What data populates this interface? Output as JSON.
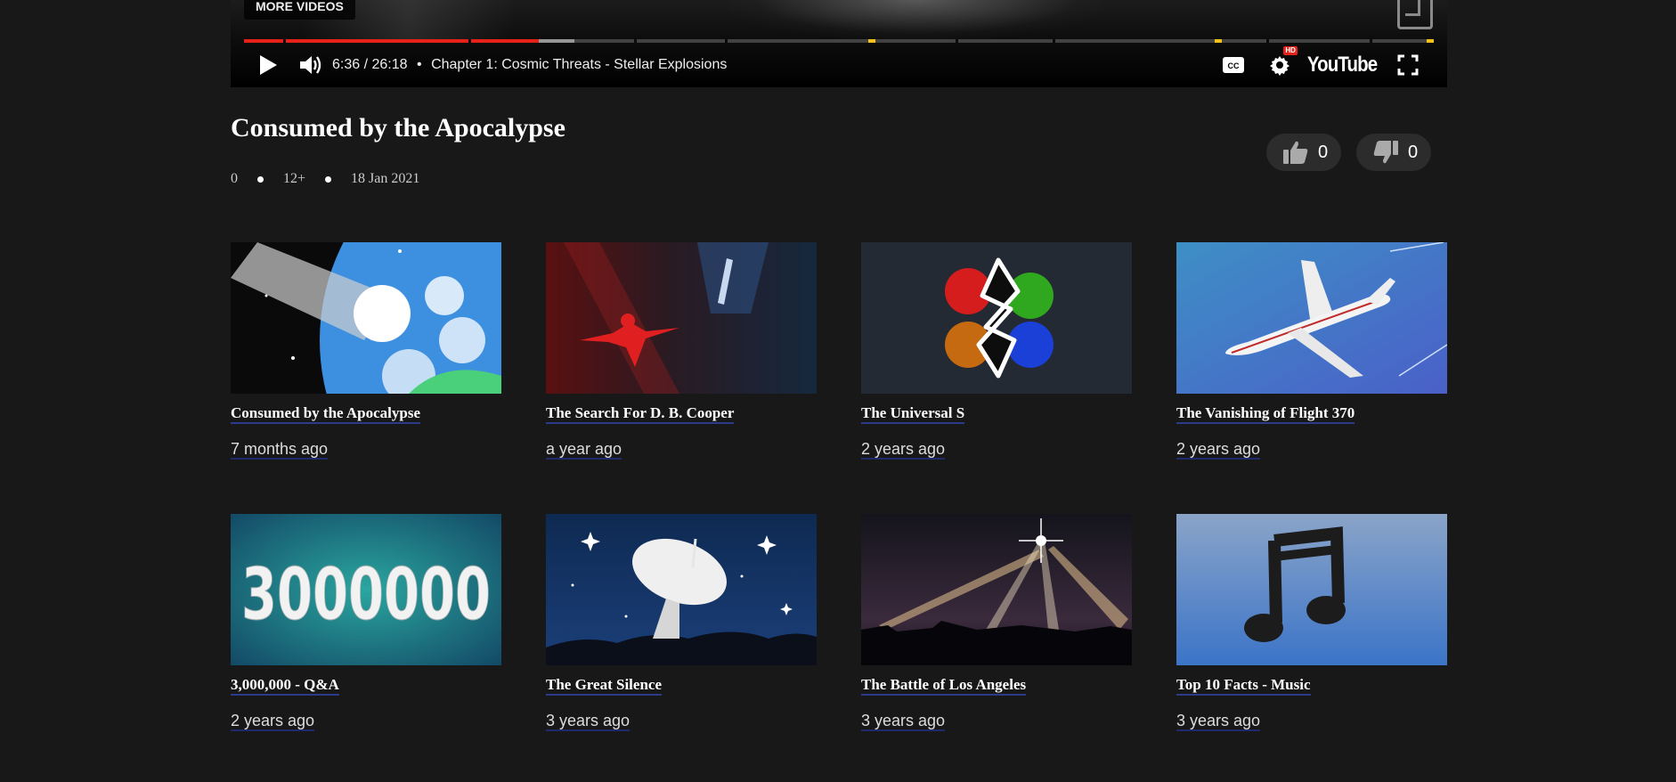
{
  "player": {
    "more_videos": "MORE VIDEOS",
    "time_current": "6:36",
    "time_separator": "/",
    "time_total": "26:18",
    "bullet": "•",
    "chapter": "Chapter 1: Cosmic Threats - Stellar Explosions",
    "progress_played": 0.248,
    "progress_buffered": 0.278,
    "brand": "YouTube",
    "hd_badge": "HD",
    "colors": {
      "played": "#e62117",
      "chapter_marker": "#f2c21a"
    }
  },
  "video": {
    "title": "Consumed by the Apocalypse",
    "views": "0",
    "age_rating": "12+",
    "date": "18 Jan 2021",
    "likes": "0",
    "dislikes": "0"
  },
  "videos": [
    {
      "title": "Consumed by the Apocalypse",
      "age": "7 months ago",
      "thumb": "comet-earth"
    },
    {
      "title": "The Search For D. B. Cooper",
      "age": "a year ago",
      "thumb": "parachute-jet"
    },
    {
      "title": "The Universal S",
      "age": "2 years ago",
      "thumb": "paint-s"
    },
    {
      "title": "The Vanishing of Flight 370",
      "age": "2 years ago",
      "thumb": "airliner"
    },
    {
      "title": "3,000,000 - Q&A",
      "age": "2 years ago",
      "thumb": "number-3000000"
    },
    {
      "title": "The Great Silence",
      "age": "3 years ago",
      "thumb": "radio-telescope"
    },
    {
      "title": "The Battle of Los Angeles",
      "age": "3 years ago",
      "thumb": "searchlights"
    },
    {
      "title": "Top 10 Facts - Music",
      "age": "3 years ago",
      "thumb": "music-note"
    }
  ],
  "thumb_text": {
    "big_number": "3000000"
  }
}
